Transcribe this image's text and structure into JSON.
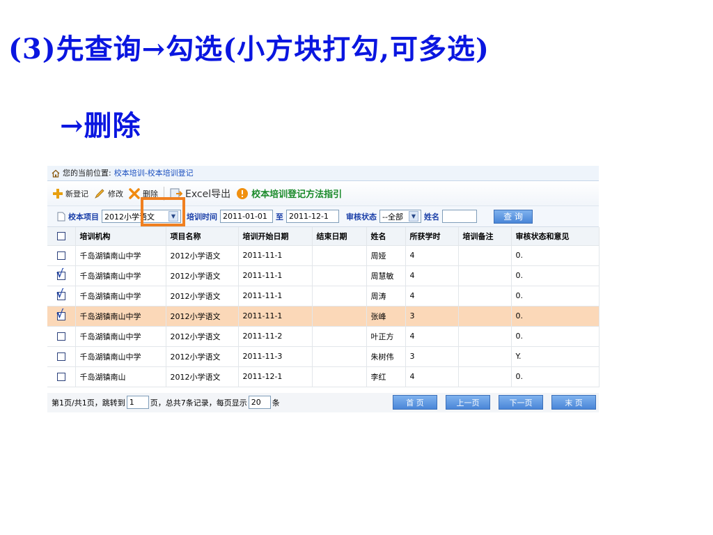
{
  "slide": {
    "title_line1": "(3)先查询→勾选(小方块打勾,可多选)",
    "title_line2": "→删除"
  },
  "location": {
    "prefix": "您的当前位置:",
    "path": "校本培训-校本培训登记"
  },
  "toolbar": {
    "new_label": "新登记",
    "edit_label": "修改",
    "delete_label": "删除",
    "export_label": "Excel导出",
    "guide_label": "校本培训登记方法指引"
  },
  "filter": {
    "project_label": "校本项目",
    "project_value": "2012小学语文",
    "time_label": "培训时间",
    "time_from": "2011-01-01",
    "time_to_label": "至",
    "time_to": "2011-12-1",
    "status_label": "审核状态",
    "status_value": "--全部",
    "name_label": "姓名",
    "name_value": "",
    "query_label": "查 询"
  },
  "table": {
    "columns": [
      "培训机构",
      "项目名称",
      "培训开始日期",
      "结束日期",
      "姓名",
      "所获学时",
      "培训备注",
      "审核状态和意见"
    ],
    "rows": [
      {
        "cells": [
          "千岛湖镇南山中学",
          "2012小学语文",
          "2011-11-1",
          "",
          "周娅",
          "4",
          "",
          "0."
        ],
        "checked": false,
        "selected": false
      },
      {
        "cells": [
          "千岛湖镇南山中学",
          "2012小学语文",
          "2011-11-1",
          "",
          "周慧敏",
          "4",
          "",
          "0."
        ],
        "checked": true,
        "selected": false
      },
      {
        "cells": [
          "千岛湖镇南山中学",
          "2012小学语文",
          "2011-11-1",
          "",
          "周涛",
          "4",
          "",
          "0."
        ],
        "checked": true,
        "selected": false
      },
      {
        "cells": [
          "千岛湖镇南山中学",
          "2012小学语文",
          "2011-11-1",
          "",
          "张峰",
          "3",
          "",
          "0."
        ],
        "checked": true,
        "selected": true
      },
      {
        "cells": [
          "千岛湖镇南山中学",
          "2012小学语文",
          "2011-11-2",
          "",
          "叶正方",
          "4",
          "",
          "0."
        ],
        "checked": false,
        "selected": false
      },
      {
        "cells": [
          "千岛湖镇南山中学",
          "2012小学语文",
          "2011-11-3",
          "",
          "朱树伟",
          "3",
          "",
          "Y."
        ],
        "checked": false,
        "selected": false
      },
      {
        "cells": [
          "千岛湖镇南山",
          "2012小学语文",
          "2011-12-1",
          "",
          "李红",
          "4",
          "",
          "0."
        ],
        "checked": false,
        "selected": false
      }
    ],
    "check_mark": "√"
  },
  "pager": {
    "text1": "第1页/共1页，跳转到",
    "page_value": "1",
    "text2": "页，总共7条记录，每页显示",
    "size_value": "20",
    "text3": "条",
    "first": "首 页",
    "prev": "上一页",
    "next": "下一页",
    "last": "末 页"
  },
  "colors": {
    "title": "#0a16e0",
    "selected_row": "#fbd8b8",
    "highlight": "#f08020"
  }
}
